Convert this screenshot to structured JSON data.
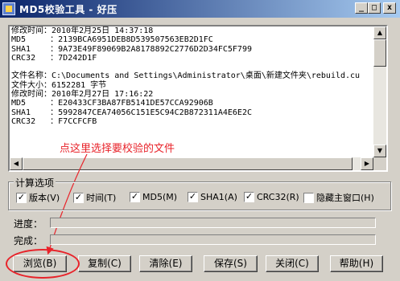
{
  "window": {
    "title": "MD5校验工具 - 好压",
    "min_label": "_",
    "max_label": "□",
    "close_label": "x"
  },
  "output_text": "修改时间：2010年2月25日 14:37:18\nMD5     ：2139BCA6951DEB8D539507563EB2D1FC\nSHA1    ：9A73E49F89069B2A8178892C2776D2D34FC5F799\nCRC32   ：7D242D1F\n\n文件名称：C:\\Documents and Settings\\Administrator\\桌面\\新建文件夹\\rebuild.cu\n文件大小：6152281 字节\n修改时间：2010年2月27日 17:16:22\nMD5     ：E20433CF3BA87FB5141DE57CCA92906B\nSHA1    ：5992847CEA74056C151E5C94C2B872311A4E6E2C\nCRC32   ：F7CCFCFB",
  "annotation": "点这里选择要校验的文件",
  "annotation_color": "#e8232a",
  "options": {
    "group_label": "计算选项",
    "items": [
      {
        "label": "版本(V)",
        "checked": true
      },
      {
        "label": "时间(T)",
        "checked": true
      },
      {
        "label": "MD5(M)",
        "checked": true
      },
      {
        "label": "SHA1(A)",
        "checked": true
      },
      {
        "label": "CRC32(R)",
        "checked": true
      },
      {
        "label": "隐藏主窗口(H)",
        "checked": false
      }
    ]
  },
  "progress": {
    "label": "进度：",
    "value": 0
  },
  "complete": {
    "label": "完成：",
    "value": 0
  },
  "buttons": {
    "browse": "浏览(B)",
    "copy": "复制(C)",
    "clear": "清除(E)",
    "save": "保存(S)",
    "close": "关闭(C)",
    "help": "帮助(H)"
  },
  "icons": {
    "app": "app-icon",
    "check": "checkmark-icon"
  }
}
